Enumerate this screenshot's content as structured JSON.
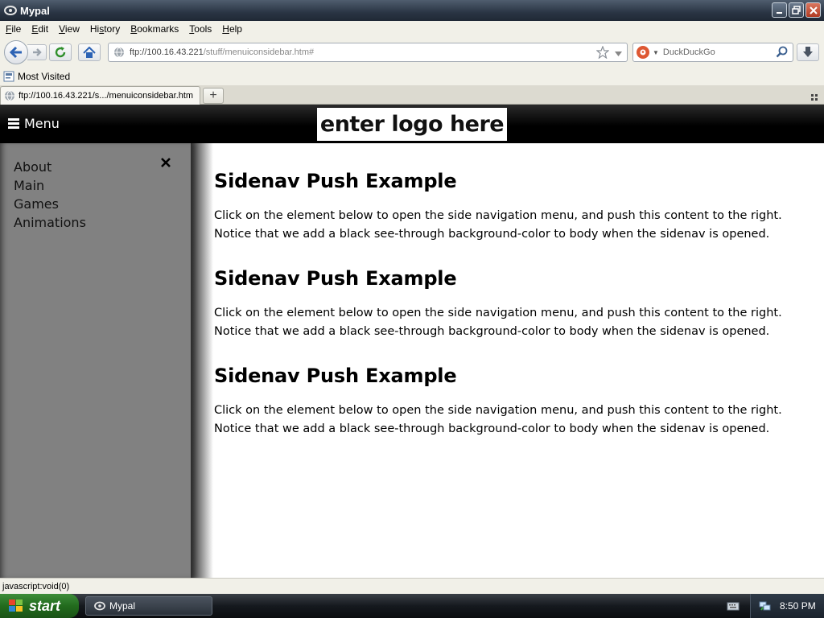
{
  "window": {
    "title": "Mypal"
  },
  "menubar": {
    "items": [
      {
        "pre": "",
        "ul": "F",
        "post": "ile"
      },
      {
        "pre": "",
        "ul": "E",
        "post": "dit"
      },
      {
        "pre": "",
        "ul": "V",
        "post": "iew"
      },
      {
        "pre": "Hi",
        "ul": "s",
        "post": "tory"
      },
      {
        "pre": "",
        "ul": "B",
        "post": "ookmarks"
      },
      {
        "pre": "",
        "ul": "T",
        "post": "ools"
      },
      {
        "pre": "",
        "ul": "H",
        "post": "elp"
      }
    ]
  },
  "navbar": {
    "url_prefix": "ftp://100.16.43.221",
    "url_rest": "/stuff/menuiconsidebar.htm#",
    "search_engine": "DuckDuckGo"
  },
  "bookmarks": {
    "most_visited": "Most Visited"
  },
  "tabs": {
    "active_label": "ftp://100.16.43.221/s.../menuiconsidebar.htm",
    "new_tab_symbol": "+"
  },
  "page": {
    "menu_label": "Menu",
    "logo_text": "enter logo here",
    "sidenav": {
      "close_symbol": "×",
      "links": [
        "About",
        "Main",
        "Games",
        "Animations"
      ]
    },
    "sections": [
      {
        "heading": "Sidenav Push Example",
        "body": "Click on the element below to open the side navigation menu, and push this content to the right. Notice that we add a black see-through background-color to body when the sidenav is opened."
      },
      {
        "heading": "Sidenav Push Example",
        "body": "Click on the element below to open the side navigation menu, and push this content to the right. Notice that we add a black see-through background-color to body when the sidenav is opened."
      },
      {
        "heading": "Sidenav Push Example",
        "body": "Click on the element below to open the side navigation menu, and push this content to the right. Notice that we add a black see-through background-color to body when the sidenav is opened."
      }
    ]
  },
  "statusbar": {
    "text": "javascript:void(0)"
  },
  "taskbar": {
    "start_label": "start",
    "task_label": "Mypal",
    "clock": "8:50 PM"
  },
  "colors": {
    "sidenav_bg": "#818181",
    "topnav_bg": "#000000",
    "start_green": "#2a7a25"
  },
  "icons": {
    "app": "mypal-icon",
    "back": "back-arrow-icon",
    "forward": "forward-arrow-icon",
    "reload": "reload-icon",
    "home": "home-icon",
    "bookmark_star": "star-icon",
    "search": "search-icon",
    "download": "download-icon",
    "menu": "hamburger-icon",
    "close": "close-icon"
  }
}
